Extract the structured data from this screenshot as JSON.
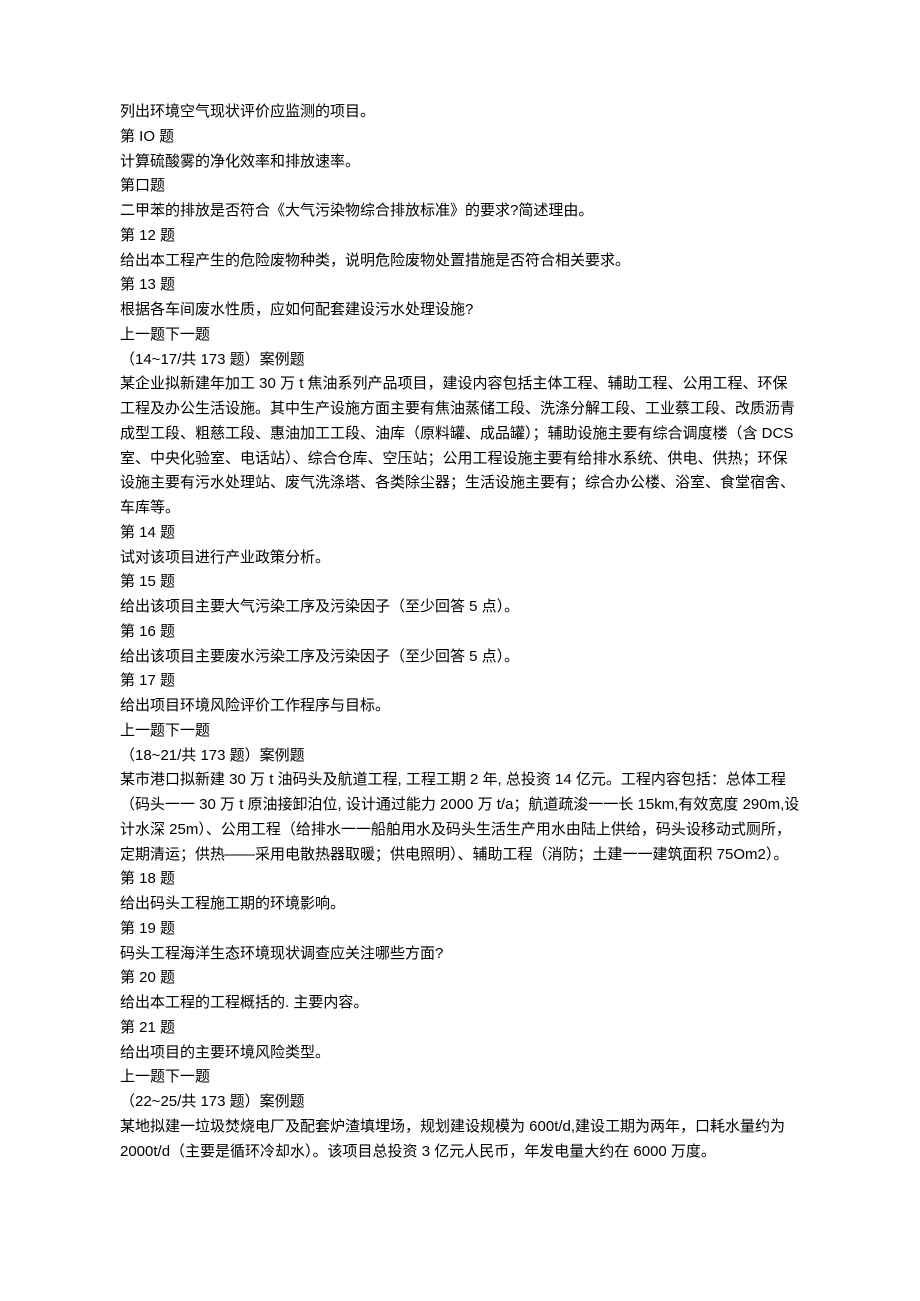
{
  "lines": [
    "列出环境空气现状评价应监测的项目。",
    "第 IO 题",
    "计算硫酸雾的净化效率和排放速率。",
    "第口题",
    "二甲苯的排放是否符合《大气污染物综合排放标准》的要求?简述理由。",
    "第 12 题",
    "给出本工程产生的危险废物种类，说明危险废物处置措施是否符合相关要求。",
    "第 13 题",
    "根据各车间废水性质，应如何配套建设污水处理设施?",
    "上一题下一题",
    "（14~17/共 173 题）案例题",
    "某企业拟新建年加工 30 万 t 焦油系列产品项目，建设内容包括主体工程、辅助工程、公用工程、环保工程及办公生活设施。其中生产设施方面主要有焦油蒸储工段、洗涤分解工段、工业蔡工段、改质沥青成型工段、粗慈工段、惠油加工工段、油库（原料罐、成品罐）；辅助设施主要有综合调度楼（含 DCS 室、中央化验室、电话站）、综合仓库、空压站；公用工程设施主要有给排水系统、供电、供热；环保设施主要有污水处理站、废气洗涤塔、各类除尘器；生活设施主要有；综合办公楼、浴室、食堂宿舍、车库等。",
    "第 14 题",
    "试对该项目进行产业政策分析。",
    "第 15 题",
    "给出该项目主要大气污染工序及污染因子（至少回答 5 点）。",
    "第 16 题",
    "给出该项目主要废水污染工序及污染因子（至少回答 5 点）。",
    "第 17 题",
    "给出项目环境风险评价工作程序与目标。",
    "上一题下一题",
    "（18~21/共 173 题）案例题",
    "某市港口拟新建 30 万 t 油码头及航道工程, 工程工期 2 年, 总投资 14 亿元。工程内容包括：总体工程（码头一一 30 万 t 原油接卸泊位, 设计通过能力 2000 万 t/a；航道疏浚一一长 15km,有效宽度 290m,设计水深 25m）、公用工程（给排水一一船舶用水及码头生活生产用水由陆上供给，码头设移动式厕所，定期清运；供热——采用电散热器取暖；供电照明）、辅助工程（消防；土建一一建筑面积 75Om2）。",
    "第 18 题",
    "给出码头工程施工期的环境影响。",
    "第 19 题",
    "码头工程海洋生态环境现状调查应关注哪些方面?",
    "第 20 题",
    "给出本工程的工程概括的. 主要内容。",
    "第 21 题",
    "给出项目的主要环境风险类型。",
    "上一题下一题",
    "（22~25/共 173 题）案例题",
    "某地拟建一垃圾焚烧电厂及配套炉渣填埋场，规划建设规模为 600t/d,建设工期为两年，口耗水量约为 2000t/d（主要是循环冷却水）。该项目总投资 3 亿元人民币，年发电量大约在 6000 万度。"
  ],
  "nav_indices": [
    9,
    20,
    31
  ],
  "heading_indices": [
    1,
    3,
    5,
    7,
    12,
    14,
    16,
    18,
    23,
    25,
    27,
    29
  ],
  "section_heading_indices": [
    10,
    21,
    32
  ]
}
